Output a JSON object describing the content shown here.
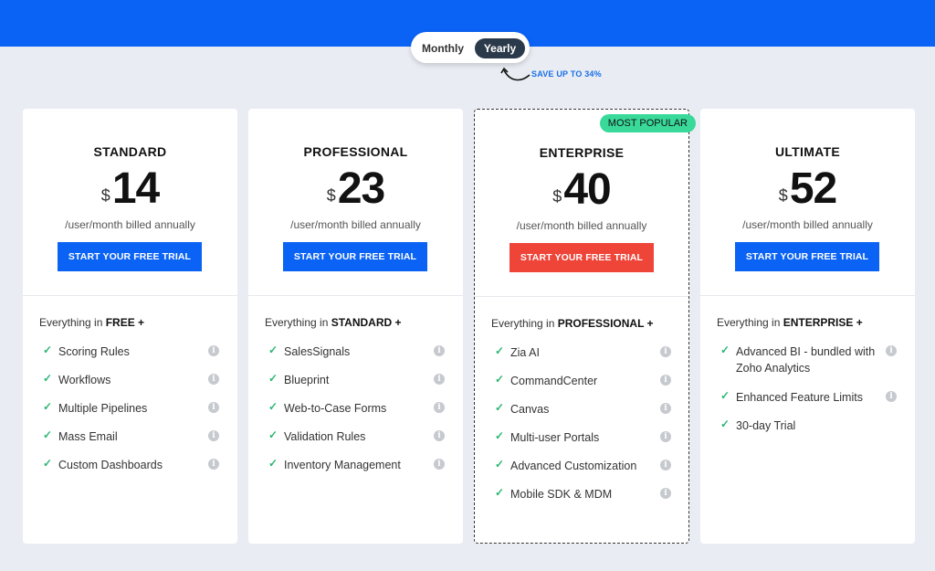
{
  "toggle": {
    "monthly": "Monthly",
    "yearly": "Yearly",
    "save": "SAVE UP TO 34%"
  },
  "plans": [
    {
      "name": "STANDARD",
      "currency": "$",
      "price": "14",
      "billing": "/user/month billed annually",
      "cta": "START YOUR FREE TRIAL",
      "everything_prefix": "Everything in",
      "everything_plan": "FREE +",
      "features": [
        "Scoring Rules",
        "Workflows",
        "Multiple Pipelines",
        "Mass Email",
        "Custom Dashboards"
      ]
    },
    {
      "name": "PROFESSIONAL",
      "currency": "$",
      "price": "23",
      "billing": "/user/month billed annually",
      "cta": "START YOUR FREE TRIAL",
      "everything_prefix": "Everything in",
      "everything_plan": "STANDARD +",
      "features": [
        "SalesSignals",
        "Blueprint",
        "Web-to-Case Forms",
        "Validation Rules",
        "Inventory Management"
      ]
    },
    {
      "name": "ENTERPRISE",
      "currency": "$",
      "price": "40",
      "billing": "/user/month billed annually",
      "cta": "START YOUR FREE TRIAL",
      "badge": "MOST POPULAR",
      "everything_prefix": "Everything in",
      "everything_plan": "PROFESSIONAL +",
      "features": [
        "Zia AI",
        "CommandCenter",
        "Canvas",
        "Multi-user Portals",
        "Advanced Customization",
        "Mobile SDK & MDM"
      ]
    },
    {
      "name": "ULTIMATE",
      "currency": "$",
      "price": "52",
      "billing": "/user/month billed annually",
      "cta": "START YOUR FREE TRIAL",
      "everything_prefix": "Everything in",
      "everything_plan": "ENTERPRISE +",
      "features": [
        "Advanced BI - bundled with Zoho Analytics",
        "Enhanced Feature Limits",
        "30-day Trial"
      ]
    }
  ],
  "colors": {
    "banner": "#0b63f5",
    "cta_blue": "#0b63f5",
    "cta_red": "#ef4438",
    "badge": "#39d99a",
    "check": "#2bb673"
  }
}
